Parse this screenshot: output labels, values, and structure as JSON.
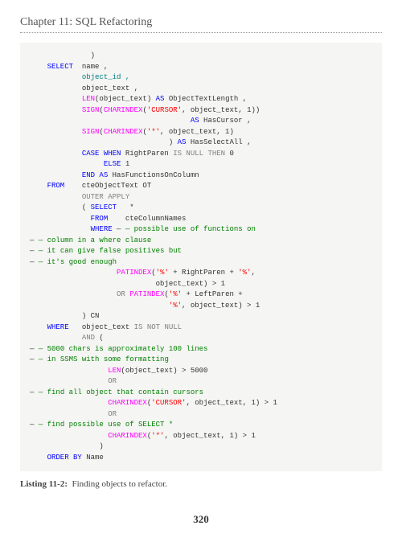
{
  "chapter": "Chapter 11: SQL Refactoring",
  "caption_label": "Listing 11-2:",
  "caption_text": "Finding objects to refactor.",
  "page_number": "320",
  "code": {
    "l01": ")",
    "l02a": "SELECT",
    "l02b": "  name ,",
    "l03": "object_id ,",
    "l04": "object_text ,",
    "l05a": "LEN",
    "l05b": "(object_text) ",
    "l05c": "AS",
    "l05d": " ObjectTextLength ,",
    "l06a": "SIGN",
    "l06b": "(",
    "l06c": "CHARINDEX",
    "l06d": "(",
    "l06e": "'CURSOR'",
    "l06f": ", object_text, 1))",
    "l07a": "AS",
    "l07b": " HasCursor ,",
    "l08a": "SIGN",
    "l08b": "(",
    "l08c": "CHARINDEX",
    "l08d": "(",
    "l08e": "'*'",
    "l08f": ", object_text, 1)",
    "l09a": ") ",
    "l09b": "AS",
    "l09c": " HasSelectAll ,",
    "l10a": "CASE WHEN",
    "l10b": " RightParen ",
    "l10c": "IS NULL THEN",
    "l10d": " 0",
    "l11a": "ELSE",
    "l11b": " 1",
    "l12a": "END AS",
    "l12b": " HasFunctionsOnColumn",
    "l13a": "FROM",
    "l13b": "    cteObjectText OT",
    "l14a": "OUTER",
    "l14b": " ",
    "l14c": "APPLY",
    "l15a": "( ",
    "l15b": "SELECT",
    "l15c": "   *",
    "l16a": "FROM",
    "l16b": "    cteColumnNames",
    "l17a": "WHERE",
    "l17b": " — ",
    "l17c": "— possible use of functions on",
    "l18a": "— ",
    "l18b": "— column in a where clause",
    "l19a": "— ",
    "l19b": "— it can give false positives but",
    "l20a": "— ",
    "l20b": "— it's good enough",
    "l21a": "PATINDEX",
    "l21b": "(",
    "l21c": "'%'",
    "l21d": " + RightParen + ",
    "l21e": "'%'",
    "l21f": ",",
    "l22": "object_text) > 1",
    "l23a": "OR",
    "l23b": " ",
    "l23c": "PATINDEX",
    "l23d": "(",
    "l23e": "'%'",
    "l23f": " + LeftParen +",
    "l24a": "'%'",
    "l24b": ", object_text) > 1",
    "l25": ") CN",
    "l26a": "WHERE",
    "l26b": "   object_text ",
    "l26c": "IS NOT NULL",
    "l27a": "AND",
    "l27b": " (",
    "l28a": "— ",
    "l28b": "— 5000 chars is approximately 100 lines",
    "l29a": "— ",
    "l29b": "— in SSMS with some formatting",
    "l30a": "LEN",
    "l30b": "(object_text) > 5000",
    "l31": "OR",
    "l32a": "— ",
    "l32b": "— find all object that contain cursors",
    "l33a": "CHARINDEX",
    "l33b": "(",
    "l33c": "'CURSOR'",
    "l33d": ", object_text, 1) > 1",
    "l34": "OR",
    "l35a": "— ",
    "l35b": "— find possible use of SELECT *",
    "l36a": "CHARINDEX",
    "l36b": "(",
    "l36c": "'*'",
    "l36d": ", object_text, 1) > 1",
    "l37": ")",
    "l38a": "ORDER BY",
    "l38b": " Name"
  }
}
